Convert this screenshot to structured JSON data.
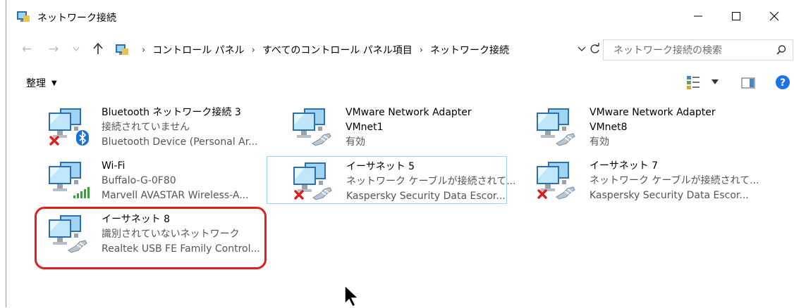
{
  "window": {
    "title": "ネットワーク接続"
  },
  "address": {
    "crumbs": [
      "コントロール パネル",
      "すべてのコントロール パネル項目",
      "ネットワーク接続"
    ]
  },
  "search": {
    "placeholder": "ネットワーク接続の検索"
  },
  "toolbar": {
    "organize_label": "整理"
  },
  "items": [
    {
      "l1": "Bluetooth ネットワーク接続 3",
      "l2": "接続されていません",
      "l3": "Bluetooth Device (Personal Ar...",
      "badge": "bluetooth",
      "status": "disconnected"
    },
    {
      "l1": "VMware Network Adapter",
      "l2": "VMnet1",
      "l3": "有効",
      "badge": "cable",
      "status": "enabled"
    },
    {
      "l1": "VMware Network Adapter",
      "l2": "VMnet8",
      "l3": "有効",
      "badge": "cable",
      "status": "enabled"
    },
    {
      "l1": "Wi-Fi",
      "l2": "Buffalo-G-0F80",
      "l3": "Marvell AVASTAR Wireless-A...",
      "badge": "wifi",
      "status": "connected"
    },
    {
      "l1": "イーサネット 5",
      "l2": "ネットワーク ケーブルが接続されて...",
      "l3": "Kaspersky Security Data Escor...",
      "badge": "cable",
      "status": "disconnected"
    },
    {
      "l1": "イーサネット 7",
      "l2": "ネットワーク ケーブルが接続されて...",
      "l3": "Kaspersky Security Data Escor...",
      "badge": "cable",
      "status": "disconnected"
    },
    {
      "l1": "イーサネット 8",
      "l2": "識別されていないネットワーク",
      "l3": "Realtek USB FE Family Control...",
      "badge": "cable",
      "status": "unidentified"
    }
  ],
  "colors": {
    "highlight": "#e02020",
    "selection": "#99d1ff",
    "help": "#1a73e8"
  }
}
